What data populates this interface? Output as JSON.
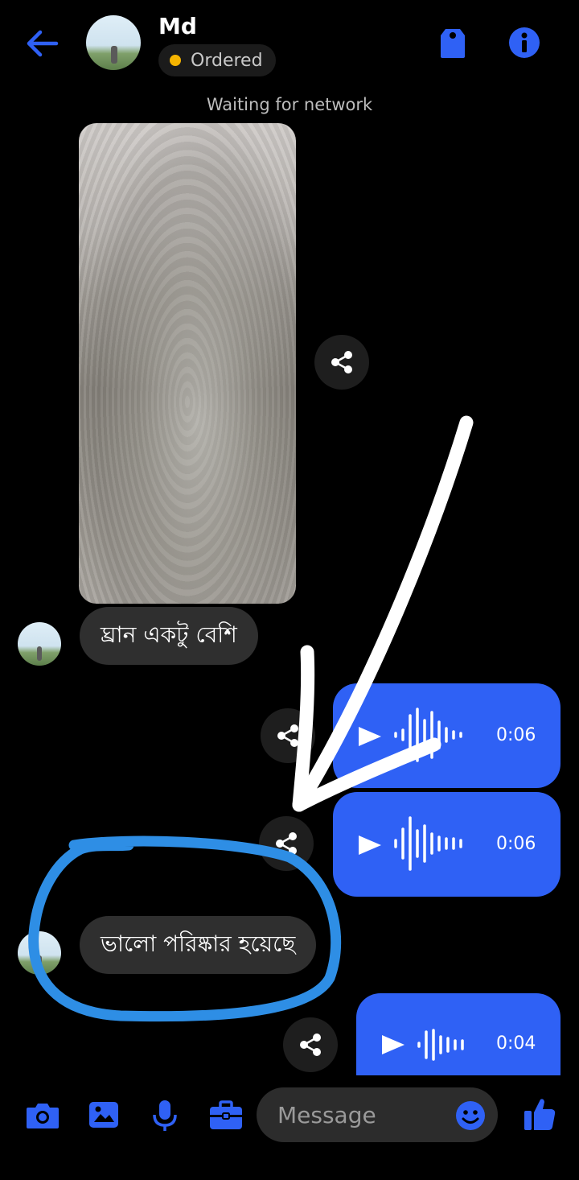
{
  "header": {
    "contact_name": "Md",
    "status_label": "Ordered",
    "status_color": "#f5b400",
    "accent_color": "#2f61f5",
    "icons": [
      "back-arrow-icon",
      "tag-icon",
      "info-icon"
    ]
  },
  "banner": {
    "waiting_text": "Waiting for network"
  },
  "messages": [
    {
      "type": "image",
      "direction": "incoming",
      "description_icon": "photo"
    },
    {
      "type": "text",
      "direction": "incoming",
      "text": "ঘ্রান একটু বেশি"
    },
    {
      "type": "voice",
      "direction": "outgoing",
      "duration": "0:06"
    },
    {
      "type": "voice",
      "direction": "outgoing",
      "duration": "0:06"
    },
    {
      "type": "text",
      "direction": "incoming",
      "text": "ভালো পরিষ্কার হয়েছে"
    },
    {
      "type": "voice",
      "direction": "outgoing",
      "duration": "0:04"
    }
  ],
  "composer": {
    "placeholder": "Message",
    "icons": [
      "camera-icon",
      "gallery-icon",
      "microphone-icon",
      "briefcase-icon",
      "emoji-icon",
      "thumbs-up-icon"
    ]
  }
}
